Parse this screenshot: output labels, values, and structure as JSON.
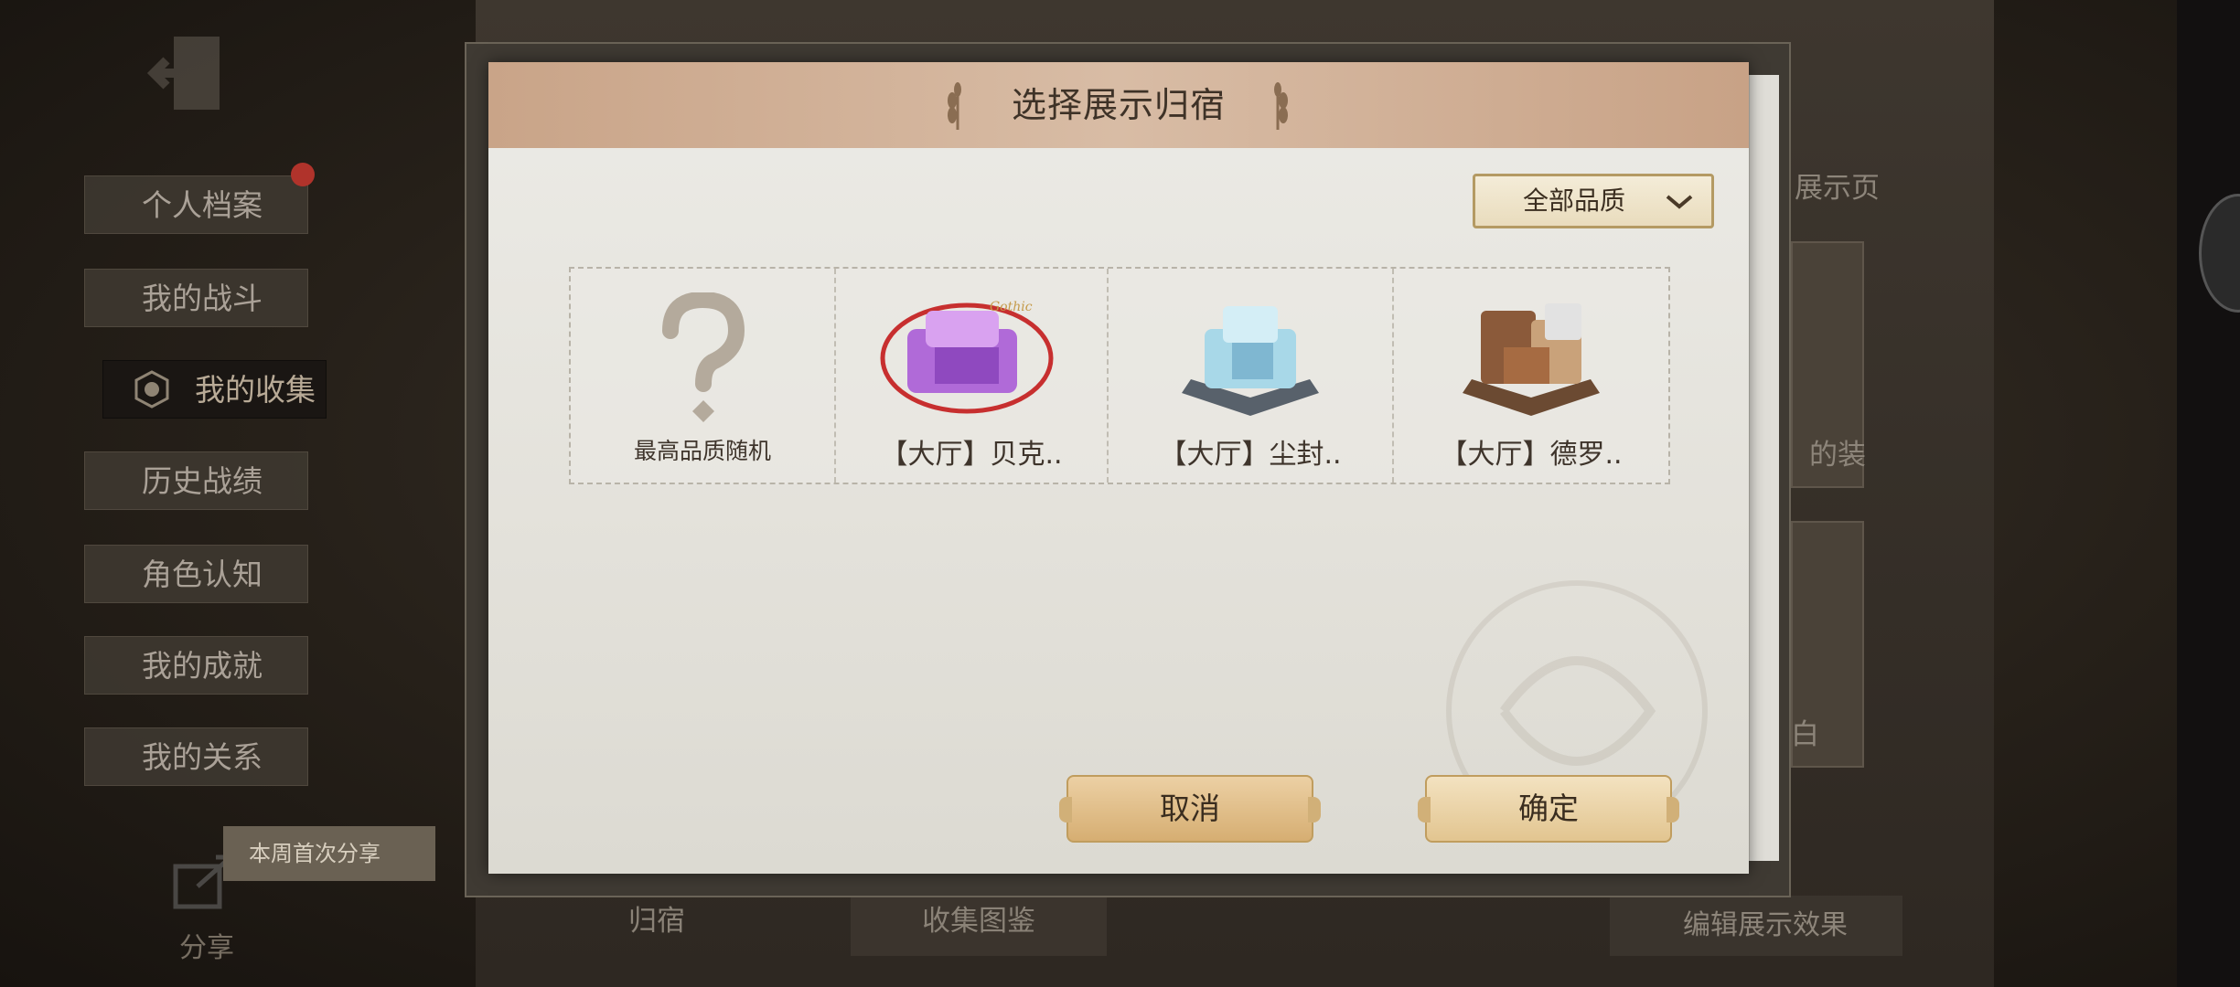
{
  "sidebar": {
    "items": [
      {
        "label": "个人档案"
      },
      {
        "label": "我的战斗"
      },
      {
        "label": "我的收集"
      },
      {
        "label": "历史战绩"
      },
      {
        "label": "角色认知"
      },
      {
        "label": "我的成就"
      },
      {
        "label": "我的关系"
      }
    ],
    "share_banner": "本周首次分享",
    "share_label": "分享"
  },
  "background": {
    "display_page_label": "展示页",
    "card_label_1": "的装",
    "card_label_2": "白",
    "edit_effect_button": "编辑展示效果",
    "collection_guide_tab": "收集图鉴",
    "home_tab": "归宿"
  },
  "modal": {
    "title": "选择展示归宿",
    "quality_filter": "全部品质",
    "options": [
      {
        "label": "最高品质随机",
        "icon": "question-mark-icon"
      },
      {
        "label": "【大厅】贝克..",
        "icon": "purple-hall-icon"
      },
      {
        "label": "【大厅】尘封..",
        "icon": "blue-hall-icon"
      },
      {
        "label": "【大厅】德罗..",
        "icon": "brown-hall-icon"
      }
    ],
    "cancel_label": "取消",
    "confirm_label": "确定"
  }
}
